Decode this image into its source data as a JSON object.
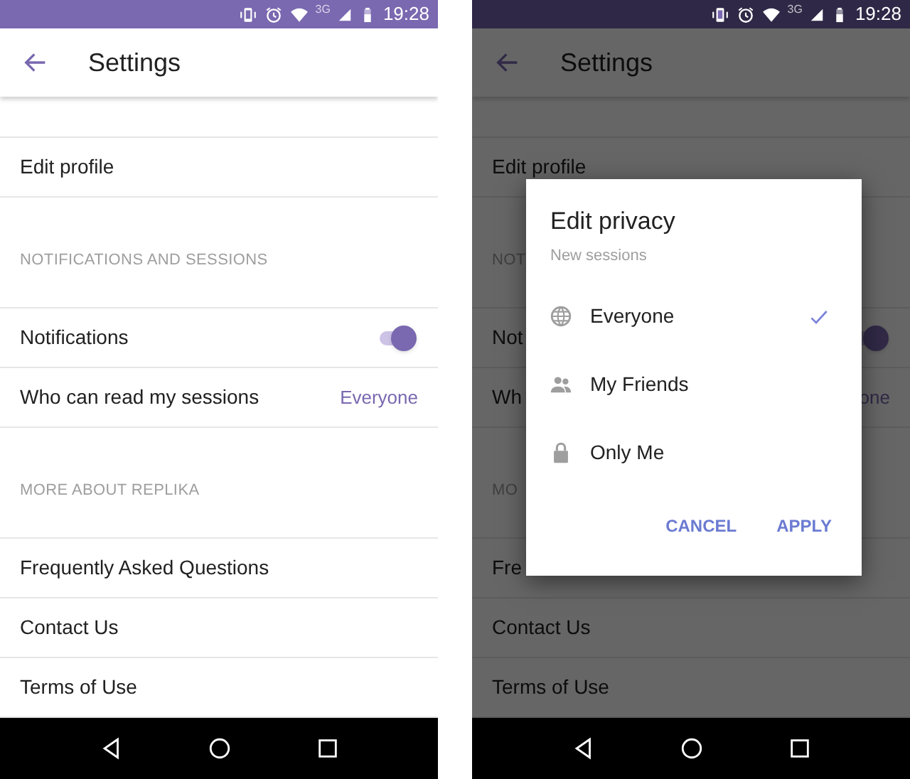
{
  "screens": [
    {
      "dimmed": false,
      "status_bar": {
        "network": "3G",
        "time": "19:28"
      },
      "app_bar": {
        "title": "Settings"
      },
      "rows": [
        {
          "kind": "item",
          "label": "Edit profile"
        },
        {
          "kind": "header",
          "label": "NOTIFICATIONS AND SESSIONS"
        },
        {
          "kind": "toggle",
          "label": "Notifications",
          "on": true
        },
        {
          "kind": "value",
          "label": "Who can read my sessions",
          "value": "Everyone"
        },
        {
          "kind": "header",
          "label": "MORE ABOUT REPLIKA"
        },
        {
          "kind": "item",
          "label": "Frequently Asked Questions"
        },
        {
          "kind": "item",
          "label": "Contact Us"
        },
        {
          "kind": "item",
          "label": "Terms of Use"
        }
      ]
    },
    {
      "dimmed": true,
      "status_bar": {
        "network": "3G",
        "time": "19:28"
      },
      "app_bar": {
        "title": "Settings"
      },
      "rows": [
        {
          "kind": "item",
          "label": "Edit profile"
        },
        {
          "kind": "header",
          "label": "NOT"
        },
        {
          "kind": "toggle",
          "label": "Not",
          "on": true
        },
        {
          "kind": "value",
          "label": "Wh",
          "value": "one"
        },
        {
          "kind": "header",
          "label": "MO"
        },
        {
          "kind": "item",
          "label": "Fre"
        },
        {
          "kind": "item",
          "label": "Contact Us"
        },
        {
          "kind": "item",
          "label": "Terms of Use"
        }
      ],
      "dialog": {
        "title": "Edit privacy",
        "subtitle": "New sessions",
        "options": [
          {
            "label": "Everyone",
            "selected": true
          },
          {
            "label": "My Friends",
            "selected": false
          },
          {
            "label": "Only Me",
            "selected": false
          }
        ],
        "buttons": [
          "CANCEL",
          "APPLY"
        ]
      }
    }
  ]
}
